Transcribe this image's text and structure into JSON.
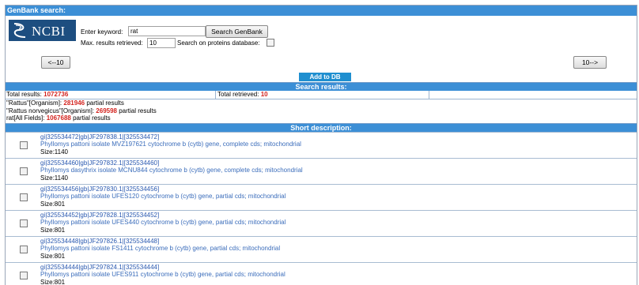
{
  "header": {
    "title": "GenBank search:"
  },
  "search": {
    "keyword_label": "Enter keyword:",
    "keyword_value": "rat",
    "search_button": "Search GenBank",
    "max_label": "Max. results retrieved:",
    "max_value": "10",
    "proteins_label": "Search on proteins database:",
    "logo_text": "NCBI"
  },
  "nav": {
    "prev_label": "<--10",
    "next_label": "10-->",
    "add_db_label": "Add to DB"
  },
  "results": {
    "header": "Search results:",
    "total_results_label": "Total results:",
    "total_results_value": "1072736",
    "total_retrieved_label": "Total retrieved:",
    "total_retrieved_value": "10",
    "queries": [
      {
        "term": "\"Rattus\"[Organism]:",
        "count": "281946",
        "suffix": "partial results"
      },
      {
        "term": "\"Rattus norvegicus\"[Organism]:",
        "count": "269598",
        "suffix": "partial results"
      },
      {
        "term": "rat[All Fields]:",
        "count": "1067688",
        "suffix": "partial results"
      }
    ]
  },
  "short_description": {
    "header": "Short description:",
    "items": [
      {
        "id": "gi|325534472|gb|JF297838.1|[325534472]",
        "desc": "Phyllomys pattoni isolate MVZ197621 cytochrome b (cytb) gene, complete cds; mitochondrial",
        "size": "Size:1140"
      },
      {
        "id": "gi|325534460|gb|JF297832.1|[325534460]",
        "desc": "Phyllomys dasythrix isolate MCNU844 cytochrome b (cytb) gene, complete cds; mitochondrial",
        "size": "Size:1140"
      },
      {
        "id": "gi|325534456|gb|JF297830.1|[325534456]",
        "desc": "Phyllomys pattoni isolate UFES120 cytochrome b (cytb) gene, partial cds; mitochondrial",
        "size": "Size:801"
      },
      {
        "id": "gi|325534452|gb|JF297828.1|[325534452]",
        "desc": "Phyllomys pattoni isolate UFES440 cytochrome b (cytb) gene, partial cds; mitochondrial",
        "size": "Size:801"
      },
      {
        "id": "gi|325534448|gb|JF297826.1|[325534448]",
        "desc": "Phyllomys pattoni isolate FS1411 cytochrome b (cytb) gene, partial cds; mitochondrial",
        "size": "Size:801"
      },
      {
        "id": "gi|325534444|gb|JF297824.1|[325534444]",
        "desc": "Phyllomys pattoni isolate UFES911 cytochrome b (cytb) gene, partial cds; mitochondrial",
        "size": "Size:801"
      }
    ]
  }
}
